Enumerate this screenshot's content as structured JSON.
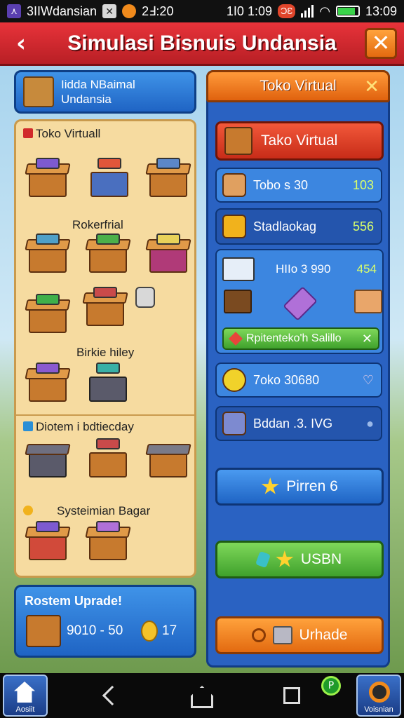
{
  "status_bar": {
    "notification_text": "3IIWdansian",
    "time_left": "2Ⅎ:20",
    "signal_text": "1I0 1:09",
    "badge_text": "ƆƐ",
    "time_right": "13:09"
  },
  "header": {
    "title": "Simulasi Bisnuis Undansia"
  },
  "left": {
    "title_card": {
      "line1": "Iidda NBaimal",
      "line2": "Undansia"
    },
    "sections": [
      {
        "label": "Toko Virtuall",
        "marker_color": "#d12b2b"
      },
      {
        "label": "Rokerfrial"
      },
      {
        "label": "Birkie hiley"
      },
      {
        "label": "Diotem i bdtiecday",
        "marker_color": "#2a8fd6"
      },
      {
        "label": "Systeimian Bagar",
        "marker_color": "#f1b21c"
      }
    ],
    "upgrade_card": {
      "title": "Rostem Uprade!",
      "value": "9010 - 50",
      "count": "17"
    }
  },
  "right": {
    "header_title": "Toko Virtual",
    "shop_button": "Tako Virtual",
    "rows": [
      {
        "label": "Tobo s 30",
        "value": "103"
      },
      {
        "label": "Stadlaokag",
        "value": "556"
      }
    ],
    "big_card": {
      "label": "HIIo 3 990",
      "value": "454",
      "banner": "Rpitenteko'h Salillo"
    },
    "row3": {
      "label": "7oko 30680"
    },
    "row4": {
      "label": "Bddan .3. IVG"
    },
    "btn_preview": "Pirren 6",
    "btn_used": "USBN",
    "btn_upgrade": "Urhade"
  },
  "nav": {
    "left_label": "Aosiit",
    "right_label": "Voisnian"
  },
  "colors": {
    "header_red": "#d9262d",
    "close_orange": "#f28a22",
    "panel_blue": "#2a62c2",
    "panel_cream": "#f6dba0",
    "value_green": "#d9ff6b"
  }
}
